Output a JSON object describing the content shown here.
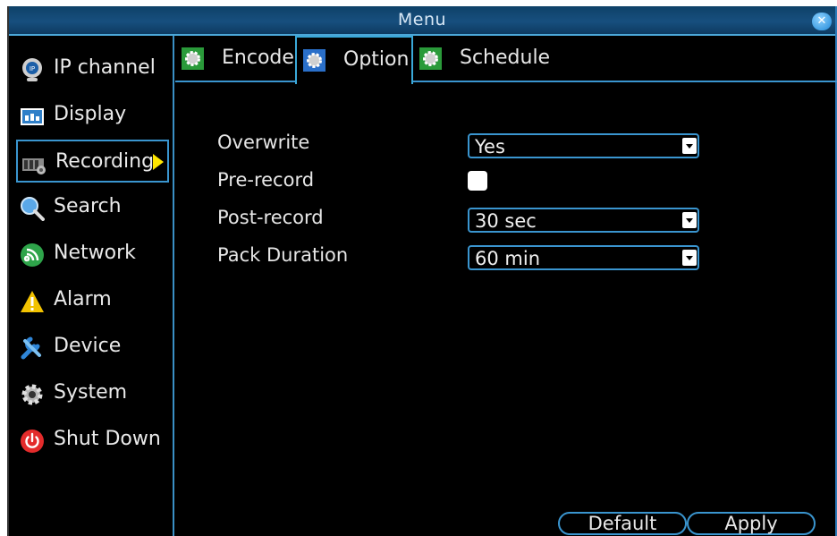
{
  "window": {
    "title": "Menu"
  },
  "sidebar": {
    "items": [
      {
        "label": "IP channel",
        "icon": "ip-camera-icon"
      },
      {
        "label": "Display",
        "icon": "display-icon"
      },
      {
        "label": "Recording",
        "icon": "recording-icon",
        "active": true
      },
      {
        "label": "Search",
        "icon": "search-icon"
      },
      {
        "label": "Network",
        "icon": "network-icon"
      },
      {
        "label": "Alarm",
        "icon": "alarm-icon"
      },
      {
        "label": "Device",
        "icon": "device-icon"
      },
      {
        "label": "System",
        "icon": "system-gear-icon"
      },
      {
        "label": "Shut Down",
        "icon": "power-icon"
      }
    ]
  },
  "tabs": [
    {
      "label": "Encode",
      "icon": "gear-icon"
    },
    {
      "label": "Option",
      "icon": "gear-icon",
      "active": true
    },
    {
      "label": "Schedule",
      "icon": "gear-icon"
    }
  ],
  "form": {
    "overwrite": {
      "label": "Overwrite",
      "value": "Yes"
    },
    "pre_record": {
      "label": "Pre-record",
      "checked": false
    },
    "post_record": {
      "label": "Post-record",
      "value": "30 sec"
    },
    "pack_duration": {
      "label": "Pack Duration",
      "value": "60 min"
    }
  },
  "buttons": {
    "default_label": "Default",
    "apply_label": "Apply"
  },
  "colors": {
    "accent": "#3a95cf",
    "titlebar": "#174f7e",
    "arrow": "#ffe600"
  }
}
